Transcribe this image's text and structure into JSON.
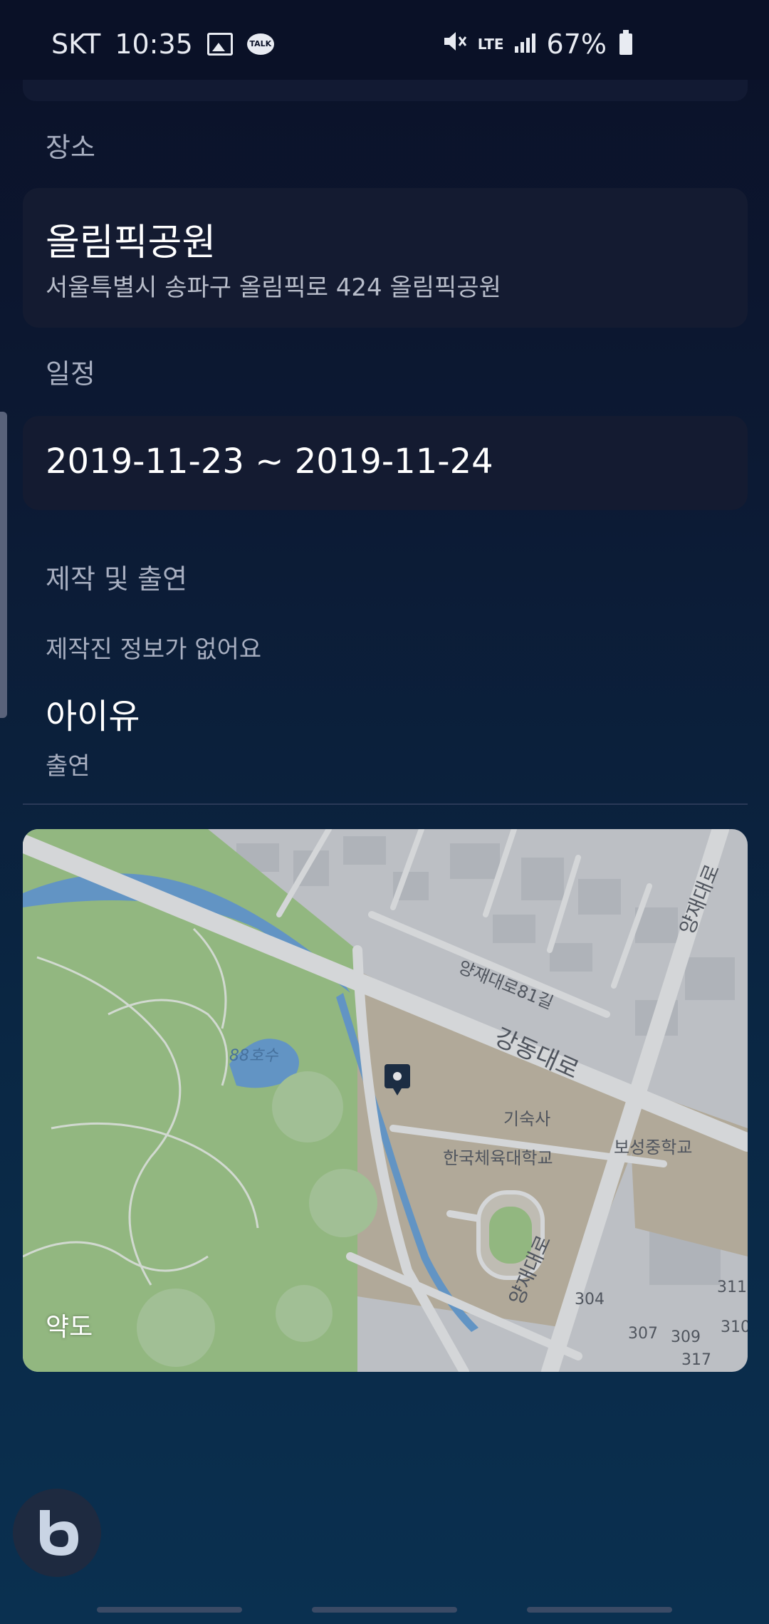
{
  "status_bar": {
    "carrier": "SKT",
    "time": "10:35",
    "network": "LTE",
    "battery": "67%"
  },
  "place": {
    "section_label": "장소",
    "name": "올림픽공원",
    "address": "서울특별시 송파구 올림픽로 424 올림픽공원"
  },
  "schedule": {
    "section_label": "일정",
    "dates": "2019-11-23 ~ 2019-11-24"
  },
  "credits": {
    "section_label": "제작 및 출연",
    "no_production_info": "제작진 정보가 없어요",
    "performer_name": "아이유",
    "performer_role": "출연"
  },
  "map": {
    "overlay_label": "약도",
    "labels": {
      "road_gangdong": "강동대로",
      "road_yangjae": "양재대로",
      "road_81gil": "양재대로81길",
      "lake": "88호수",
      "dorm": "기숙사",
      "univ": "한국체육대학교",
      "school": "보성중학교",
      "road_side": "양재대로",
      "n304": "304",
      "n307": "307",
      "n309": "309",
      "n317": "317",
      "n311": "311",
      "n310": "310"
    }
  },
  "colors": {
    "park_green": "#a6cf8c",
    "road": "#f1f2f1",
    "water": "#6fa7da"
  }
}
